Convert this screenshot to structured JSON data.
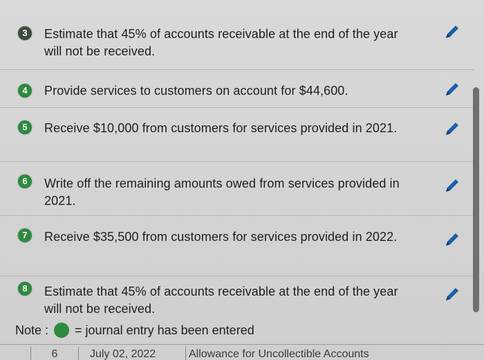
{
  "rows": [
    {
      "num": "3",
      "text": "Estimate that 45% of accounts receivable at the end of the year will not be received."
    },
    {
      "num": "4",
      "text": "Provide services to customers on account for $44,600."
    },
    {
      "num": "5",
      "text": "Receive $10,000 from customers for services provided in 2021."
    },
    {
      "num": "6",
      "text": "Write off the remaining amounts owed from services provided in 2021."
    },
    {
      "num": "7",
      "text": "Receive $35,500 from customers for services provided in 2022."
    },
    {
      "num": "8",
      "text": "Estimate that 45% of accounts receivable at the end of the year will not be received."
    }
  ],
  "note": {
    "label": "Note :",
    "text": "= journal entry has been entered"
  },
  "table_row": {
    "num": "6",
    "date": "July 02, 2022",
    "account": "Allowance for Uncollectible Accounts"
  },
  "colors": {
    "entered_green": "#2d8a3e",
    "pencil_blue": "#1a5fa8"
  },
  "icons": {
    "edit": "pencil-icon",
    "status": "journal-entered-dot"
  }
}
